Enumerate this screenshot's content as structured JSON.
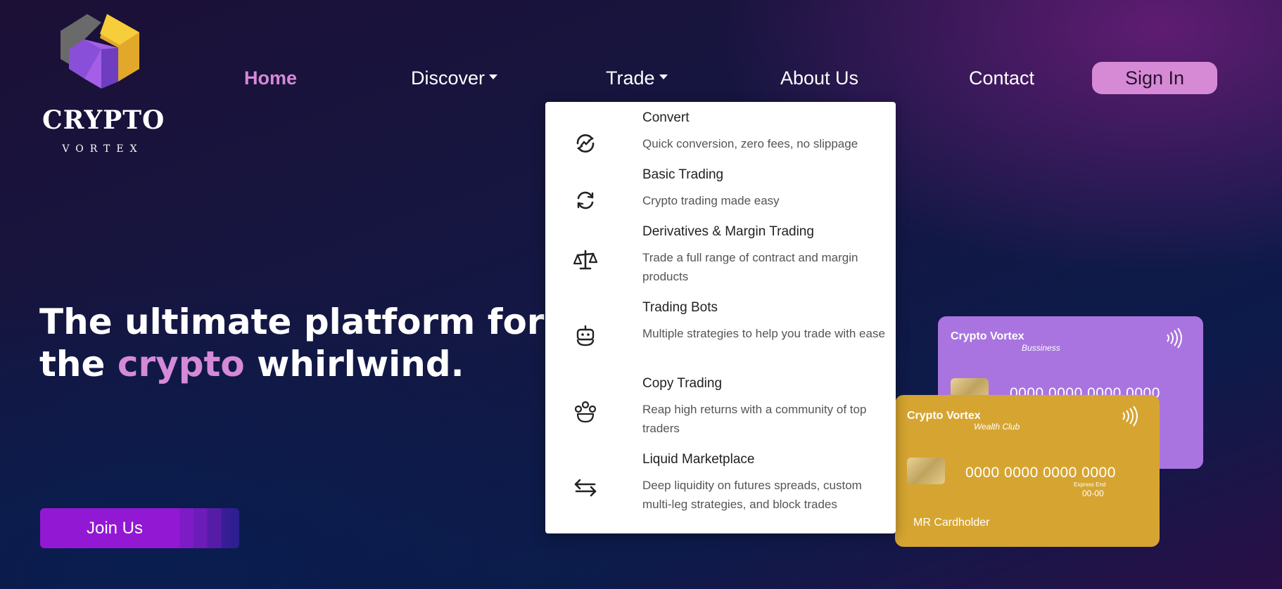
{
  "logo": {
    "word": "CRYPTO",
    "sub": "VORTEX"
  },
  "nav": {
    "home": "Home",
    "discover": "Discover",
    "trade": "Trade",
    "about": "About Us",
    "contact": "Contact",
    "signin": "Sign In"
  },
  "hero": {
    "line1": "The ultimate platform for tradin",
    "line2_pre": "the ",
    "line2_accent": "crypto",
    "line2_post": " whirlwind."
  },
  "join_label": "Join Us",
  "trade_menu": [
    {
      "icon": "convert-icon",
      "title": "Convert",
      "desc": "Quick conversion, zero fees, no slippage"
    },
    {
      "icon": "refresh-arrows-icon",
      "title": "Basic Trading",
      "desc": "Crypto trading made easy"
    },
    {
      "icon": "scales-icon",
      "title": "Derivatives & Margin Trading",
      "desc": "Trade a full range of contract and margin products"
    },
    {
      "icon": "robot-icon",
      "title": "Trading Bots",
      "desc": "Multiple strategies to help you trade with ease"
    },
    {
      "icon": "community-icon",
      "title": "Copy Trading",
      "desc": "Reap high returns with a community of top traders"
    },
    {
      "icon": "exchange-arrows-icon",
      "title": "Liquid Marketplace",
      "desc": "Deep liquidity on futures spreads, custom multi-leg strategies, and block trades"
    }
  ],
  "cards": {
    "purple": {
      "brand": "Crypto Vortex",
      "tier": "Bussiness",
      "number": "0000 0000 0000 0000"
    },
    "gold": {
      "brand": "Crypto Vortex",
      "tier": "Wealth Club",
      "number": "0000 0000 0000 0000",
      "expiry_label": "Express End",
      "expiry": "00-00",
      "holder": "MR Cardholder"
    }
  },
  "colors": {
    "accent_pink": "#d48ad8",
    "signin_bg": "#d68ad6",
    "join_bg": "#9218d4",
    "card_purple": "#a974e0",
    "card_gold": "#d6a531"
  }
}
